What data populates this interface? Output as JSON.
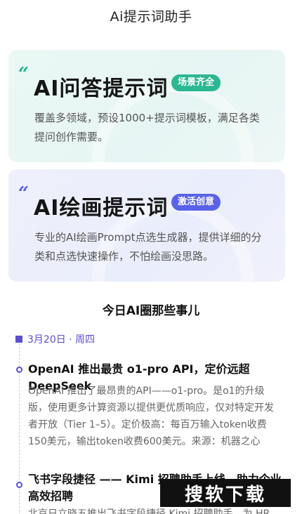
{
  "header": {
    "title": "Ai提示词助手"
  },
  "cards": [
    {
      "quote": "“",
      "title": "AI问答提示词",
      "badge": "场景齐全",
      "desc": "覆盖多领域，预设1000+提示词模板，满足各类提问创作需要。"
    },
    {
      "quote": "“",
      "title": "AI绘画提示词",
      "badge": "激活创意",
      "desc": "专业的AI绘画Prompt点选生成器，提供详细的分类和点选快速操作，不怕绘画没思路。"
    }
  ],
  "news": {
    "section_title": "今日AI圈那些事儿",
    "date": "3月20日 · 周四",
    "items": [
      {
        "title": "OpenAI 推出最贵 o1-pro API，定价远超 DeepSeek",
        "body": "OpenAI 推出了最昂贵的API——o1-pro。是o1的升级版，使用更多计算资源以提供更优质响应，仅对特定开发者开放（Tier 1–5）。定价极高：每百万输入token收费150美元，输出token收费600美元。来源：机器之心"
      },
      {
        "title": "飞书字段捷径 —— Kimi 招聘助手上线，助力企业高效招聘",
        "body": "北京日立晓五推出飞书字段捷径 Kimi 招聘助手，为 HR 提"
      }
    ]
  },
  "watermark": {
    "text": "搜软下载"
  },
  "colors": {
    "green": "#2bb792",
    "indigo": "#5a62e8",
    "purple": "#5a50cf"
  }
}
